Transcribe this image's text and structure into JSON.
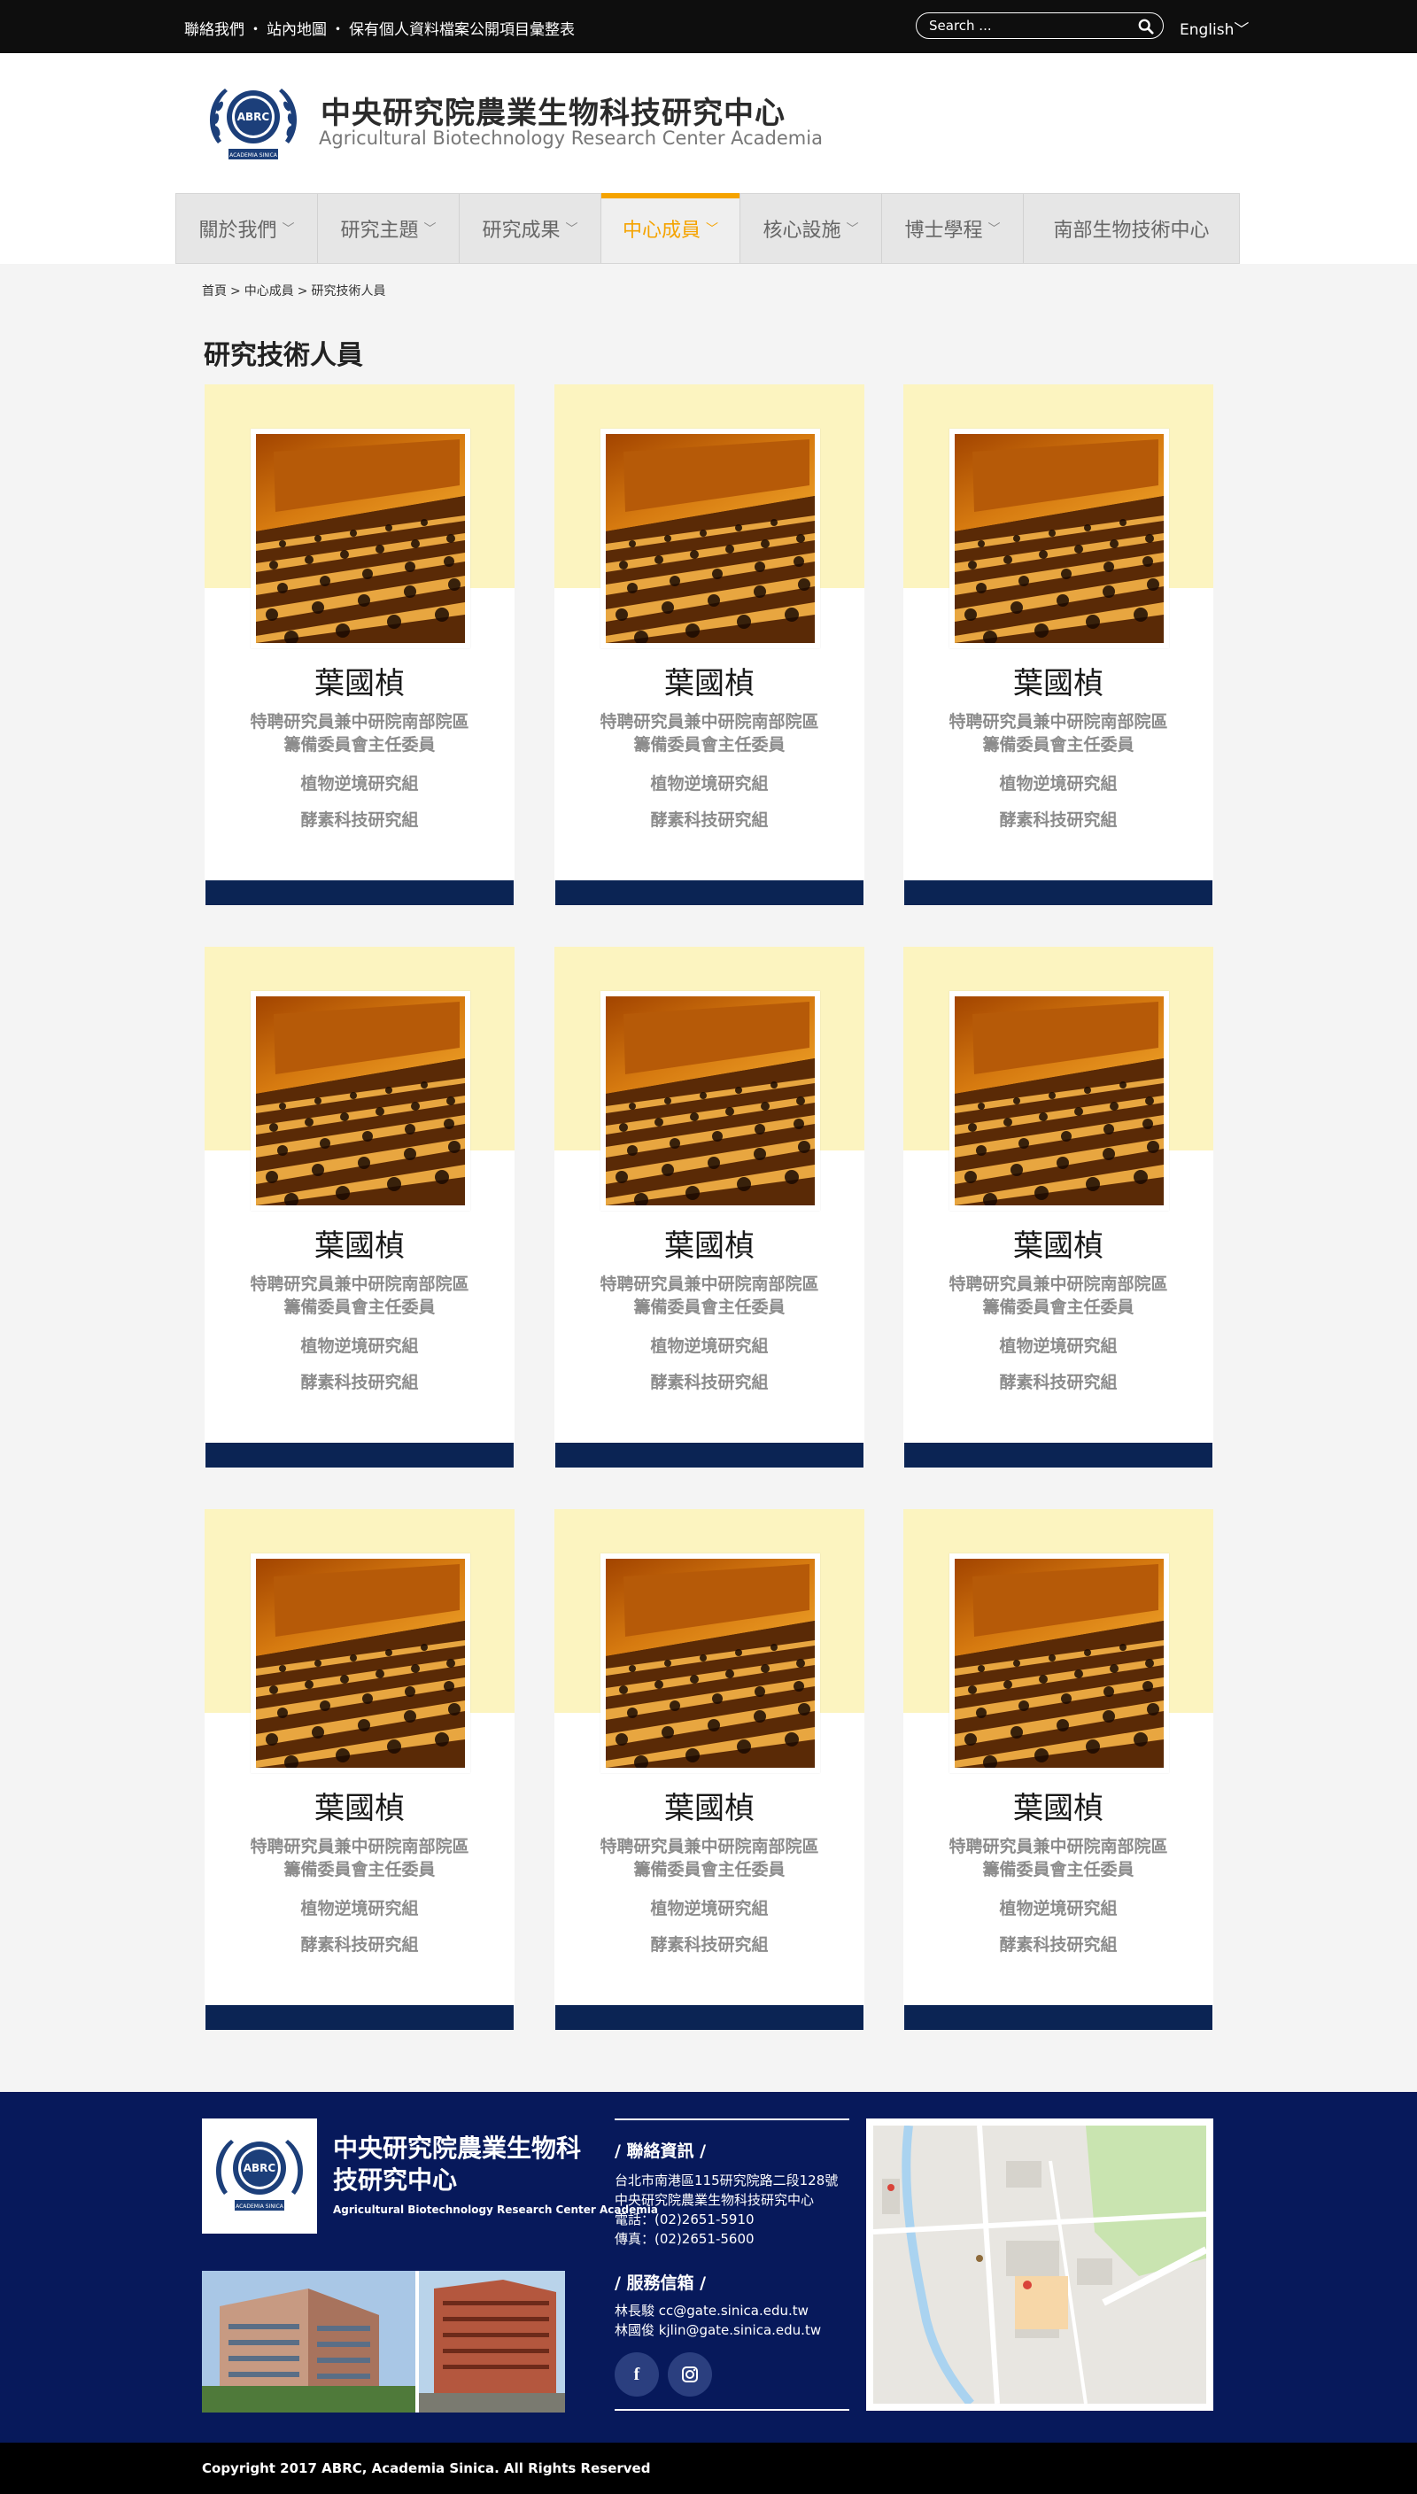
{
  "topbar": {
    "links": [
      "聯絡我們",
      "站內地圖",
      "保有個人資料檔案公開項目彙整表"
    ],
    "separator": "・",
    "search_placeholder": "Search ...",
    "language": "English"
  },
  "header": {
    "title_zh": "中央研究院農業生物科技研究中心",
    "title_en": "Agricultural Biotechnology Research Center Academia",
    "logo_text": "ABRC",
    "logo_subtext": "ACADEMIA SINICA"
  },
  "nav": {
    "items": [
      {
        "label": "關於我們",
        "has_dropdown": true,
        "active": false
      },
      {
        "label": "研究主題",
        "has_dropdown": true,
        "active": false
      },
      {
        "label": "研究成果",
        "has_dropdown": true,
        "active": false
      },
      {
        "label": "中心成員",
        "has_dropdown": true,
        "active": true
      },
      {
        "label": "核心設施",
        "has_dropdown": true,
        "active": false
      },
      {
        "label": "博士學程",
        "has_dropdown": true,
        "active": false
      },
      {
        "label": "南部生物技術中心",
        "has_dropdown": false,
        "active": false
      }
    ],
    "active_color": "#f5a300"
  },
  "breadcrumb": [
    "首頁",
    "中心成員",
    "研究技術人員"
  ],
  "breadcrumb_sep": ">",
  "page_title": "研究技術人員",
  "cards": [
    {
      "name": "葉國楨",
      "role_line1": "特聘研究員兼中研院南部院區",
      "role_line2": "籌備委員會主任委員",
      "group1": "植物逆境研究組",
      "group2": "酵素科技研究組"
    },
    {
      "name": "葉國楨",
      "role_line1": "特聘研究員兼中研院南部院區",
      "role_line2": "籌備委員會主任委員",
      "group1": "植物逆境研究組",
      "group2": "酵素科技研究組"
    },
    {
      "name": "葉國楨",
      "role_line1": "特聘研究員兼中研院南部院區",
      "role_line2": "籌備委員會主任委員",
      "group1": "植物逆境研究組",
      "group2": "酵素科技研究組"
    },
    {
      "name": "葉國楨",
      "role_line1": "特聘研究員兼中研院南部院區",
      "role_line2": "籌備委員會主任委員",
      "group1": "植物逆境研究組",
      "group2": "酵素科技研究組"
    },
    {
      "name": "葉國楨",
      "role_line1": "特聘研究員兼中研院南部院區",
      "role_line2": "籌備委員會主任委員",
      "group1": "植物逆境研究組",
      "group2": "酵素科技研究組"
    },
    {
      "name": "葉國楨",
      "role_line1": "特聘研究員兼中研院南部院區",
      "role_line2": "籌備委員會主任委員",
      "group1": "植物逆境研究組",
      "group2": "酵素科技研究組"
    },
    {
      "name": "葉國楨",
      "role_line1": "特聘研究員兼中研院南部院區",
      "role_line2": "籌備委員會主任委員",
      "group1": "植物逆境研究組",
      "group2": "酵素科技研究組"
    },
    {
      "name": "葉國楨",
      "role_line1": "特聘研究員兼中研院南部院區",
      "role_line2": "籌備委員會主任委員",
      "group1": "植物逆境研究組",
      "group2": "酵素科技研究組"
    },
    {
      "name": "葉國楨",
      "role_line1": "特聘研究員兼中研院南部院區",
      "role_line2": "籌備委員會主任委員",
      "group1": "植物逆境研究組",
      "group2": "酵素科技研究組"
    }
  ],
  "footer": {
    "title_zh": "中央研究院農業生物科技研究中心",
    "title_en": "Agricultural Biotechnology Research Center Academia",
    "contact_heading": "/ 聯絡資訊 /",
    "address_line1": "台北市南港區115研究院路二段128號",
    "address_line2": "中央研究院農業生物科技研究中心",
    "phone": "電話：(02)2651-5910",
    "fax": "傳真：(02)2651-5600",
    "mail_heading": "/ 服務信箱 /",
    "mail1": "林長駿  cc@gate.sinica.edu.tw",
    "mail2": "林國俊  kjlin@gate.sinica.edu.tw",
    "socials": [
      "f",
      "ig"
    ],
    "copyright": "Copyright 2017 ABRC, Academia Sinica. All Rights Reserved"
  },
  "colors": {
    "navy": "#0b2454",
    "footer_bg": "#07195b",
    "band": "#fcf4c0",
    "accent": "#f5a300"
  }
}
